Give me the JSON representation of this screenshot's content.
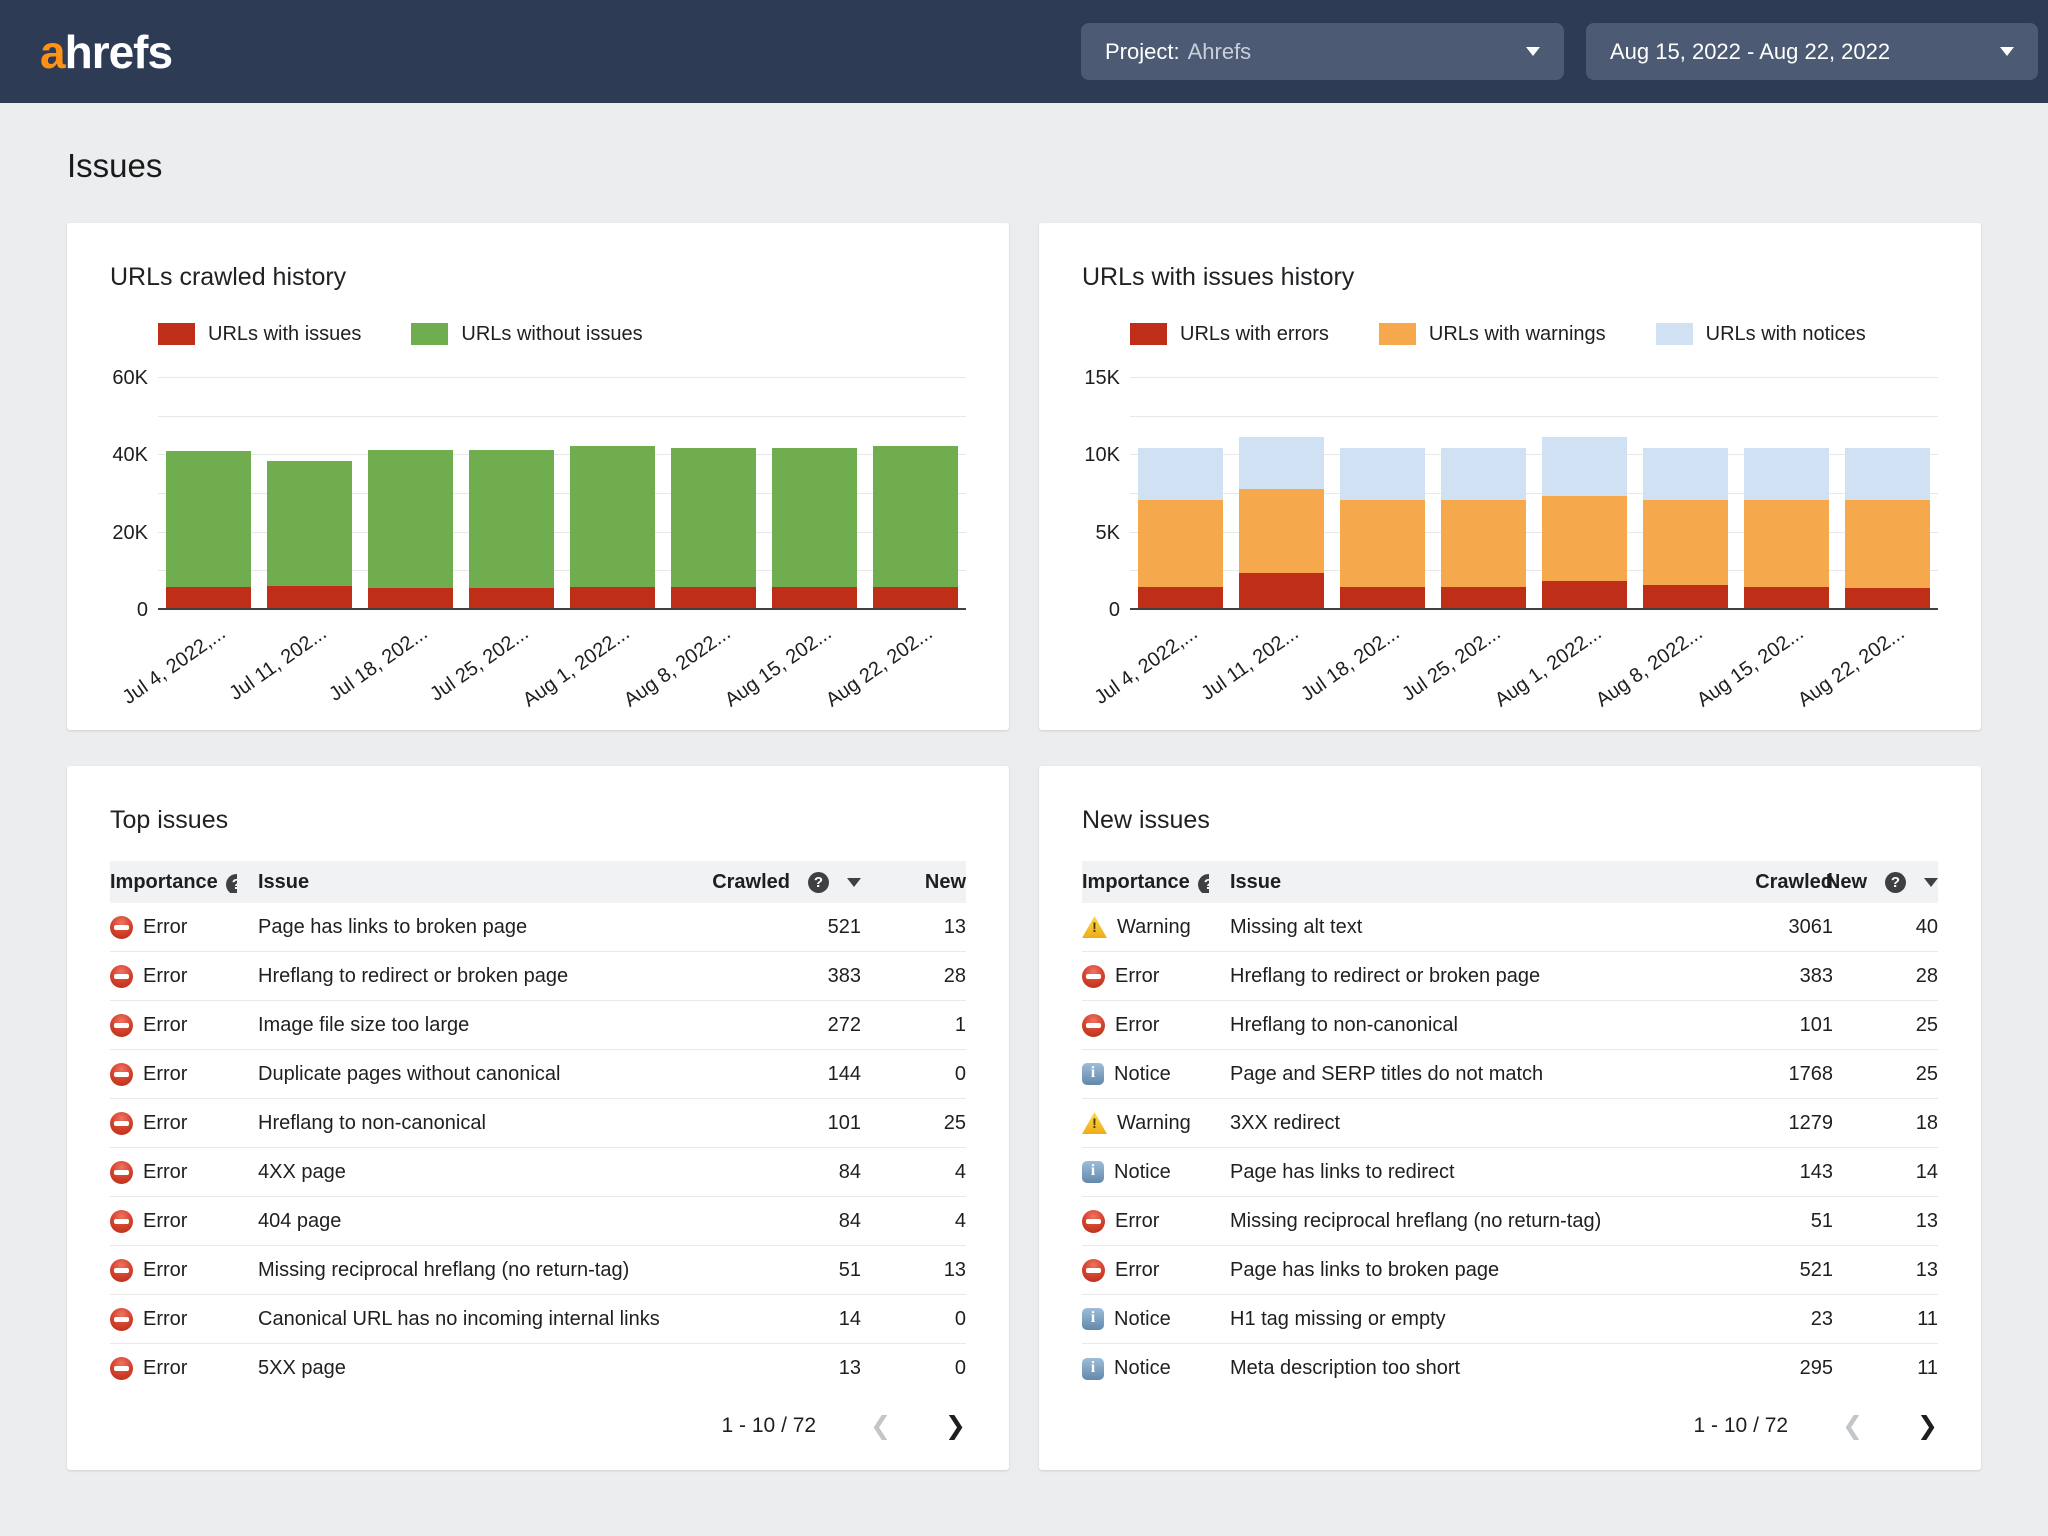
{
  "header": {
    "logo_prefix": "a",
    "logo_rest": "hrefs",
    "project_dropdown": {
      "label": "Project:",
      "value": "Ahrefs"
    },
    "date_dropdown": {
      "value": "Aug 15, 2022 - Aug 22, 2022"
    }
  },
  "page_title": "Issues",
  "icons": {
    "dropdown": "chevron-down",
    "help": "?",
    "sort": "caret-down",
    "prev": "❮",
    "next": "❯"
  },
  "colors": {
    "topbar": "#2e3b54",
    "dropdown": "#4c5a74",
    "logo_orange": "#ff9116",
    "error_red": "#bf2e18",
    "ok_green": "#6fad4f",
    "warning_orange": "#f5a84c",
    "notice_blue": "#cfe1f3",
    "page_bg": "#ebedef"
  },
  "chart_data": [
    {
      "type": "bar",
      "stacked": true,
      "title": "URLs crawled history",
      "categories": [
        "Jul 4, 2022,...",
        "Jul 11, 202...",
        "Jul 18, 202...",
        "Jul 25, 202...",
        "Aug 1, 2022...",
        "Aug 8, 2022...",
        "Aug 15, 202...",
        "Aug 22, 202..."
      ],
      "series": [
        {
          "name": "URLs with issues",
          "color": "#bf2e18",
          "values": [
            5900,
            6200,
            5800,
            5700,
            6000,
            5900,
            6000,
            6000
          ]
        },
        {
          "name": "URLs without issues",
          "color": "#6fad4f",
          "values": [
            35100,
            32300,
            35700,
            35800,
            36500,
            36100,
            36000,
            36500
          ]
        }
      ],
      "ylim": [
        0,
        60000
      ],
      "ytick_values": [
        0,
        20000,
        40000,
        60000
      ],
      "ytick_labels": [
        "0",
        "20K",
        "40K",
        "60K"
      ],
      "grid_step": 10000,
      "legend_position": "top",
      "grid": true
    },
    {
      "type": "bar",
      "stacked": true,
      "title": "URLs with issues history",
      "categories": [
        "Jul 4, 2022,...",
        "Jul 11, 202...",
        "Jul 18, 202...",
        "Jul 25, 202...",
        "Aug 1, 2022...",
        "Aug 8, 2022...",
        "Aug 15, 202...",
        "Aug 22, 202..."
      ],
      "series": [
        {
          "name": "URLs with errors",
          "color": "#bf2e18",
          "values": [
            1500,
            2400,
            1500,
            1500,
            1900,
            1600,
            1500,
            1400
          ]
        },
        {
          "name": "URLs with warnings",
          "color": "#f5a84c",
          "values": [
            5600,
            5400,
            5600,
            5600,
            5500,
            5500,
            5600,
            5700
          ]
        },
        {
          "name": "URLs with notices",
          "color": "#cfe1f3",
          "values": [
            3400,
            3400,
            3400,
            3400,
            3800,
            3400,
            3400,
            3400
          ]
        }
      ],
      "ylim": [
        0,
        15000
      ],
      "ytick_values": [
        0,
        5000,
        10000,
        15000
      ],
      "ytick_labels": [
        "0",
        "5K",
        "10K",
        "15K"
      ],
      "grid_step": 2500,
      "legend_position": "top",
      "grid": true
    }
  ],
  "tables": [
    {
      "title": "Top issues",
      "columns": [
        {
          "label": "Importance",
          "clipped_help": true
        },
        {
          "label": "Issue"
        },
        {
          "label": "Crawled",
          "help": true,
          "sort": "desc"
        },
        {
          "label": "New"
        }
      ],
      "rows": [
        {
          "importance": "Error",
          "severity": "error",
          "issue": "Page has links to broken page",
          "crawled": "521",
          "new": "13"
        },
        {
          "importance": "Error",
          "severity": "error",
          "issue": "Hreflang to redirect or broken page",
          "crawled": "383",
          "new": "28"
        },
        {
          "importance": "Error",
          "severity": "error",
          "issue": "Image file size too large",
          "crawled": "272",
          "new": "1"
        },
        {
          "importance": "Error",
          "severity": "error",
          "issue": "Duplicate pages without canonical",
          "crawled": "144",
          "new": "0"
        },
        {
          "importance": "Error",
          "severity": "error",
          "issue": "Hreflang to non-canonical",
          "crawled": "101",
          "new": "25"
        },
        {
          "importance": "Error",
          "severity": "error",
          "issue": "4XX page",
          "crawled": "84",
          "new": "4"
        },
        {
          "importance": "Error",
          "severity": "error",
          "issue": "404 page",
          "crawled": "84",
          "new": "4"
        },
        {
          "importance": "Error",
          "severity": "error",
          "issue": "Missing reciprocal hreflang (no return-tag)",
          "crawled": "51",
          "new": "13"
        },
        {
          "importance": "Error",
          "severity": "error",
          "issue": "Canonical URL has no incoming internal links",
          "crawled": "14",
          "new": "0"
        },
        {
          "importance": "Error",
          "severity": "error",
          "issue": "5XX page",
          "crawled": "13",
          "new": "0"
        }
      ],
      "pagination": "1 - 10 / 72"
    },
    {
      "title": "New issues",
      "columns": [
        {
          "label": "Importance",
          "clipped_help": true
        },
        {
          "label": "Issue"
        },
        {
          "label": "Crawled"
        },
        {
          "label": "New",
          "help": true,
          "sort": "desc"
        }
      ],
      "rows": [
        {
          "importance": "Warning",
          "severity": "warning",
          "issue": "Missing alt text",
          "crawled": "3061",
          "new": "40"
        },
        {
          "importance": "Error",
          "severity": "error",
          "issue": "Hreflang to redirect or broken page",
          "crawled": "383",
          "new": "28"
        },
        {
          "importance": "Error",
          "severity": "error",
          "issue": "Hreflang to non-canonical",
          "crawled": "101",
          "new": "25"
        },
        {
          "importance": "Notice",
          "severity": "notice",
          "issue": "Page and SERP titles do not match",
          "crawled": "1768",
          "new": "25"
        },
        {
          "importance": "Warning",
          "severity": "warning",
          "issue": "3XX redirect",
          "crawled": "1279",
          "new": "18"
        },
        {
          "importance": "Notice",
          "severity": "notice",
          "issue": "Page has links to redirect",
          "crawled": "143",
          "new": "14"
        },
        {
          "importance": "Error",
          "severity": "error",
          "issue": "Missing reciprocal hreflang (no return-tag)",
          "crawled": "51",
          "new": "13"
        },
        {
          "importance": "Error",
          "severity": "error",
          "issue": "Page has links to broken page",
          "crawled": "521",
          "new": "13"
        },
        {
          "importance": "Notice",
          "severity": "notice",
          "issue": "H1 tag missing or empty",
          "crawled": "23",
          "new": "11"
        },
        {
          "importance": "Notice",
          "severity": "notice",
          "issue": "Meta description too short",
          "crawled": "295",
          "new": "11"
        }
      ],
      "pagination": "1 - 10 / 72"
    }
  ]
}
